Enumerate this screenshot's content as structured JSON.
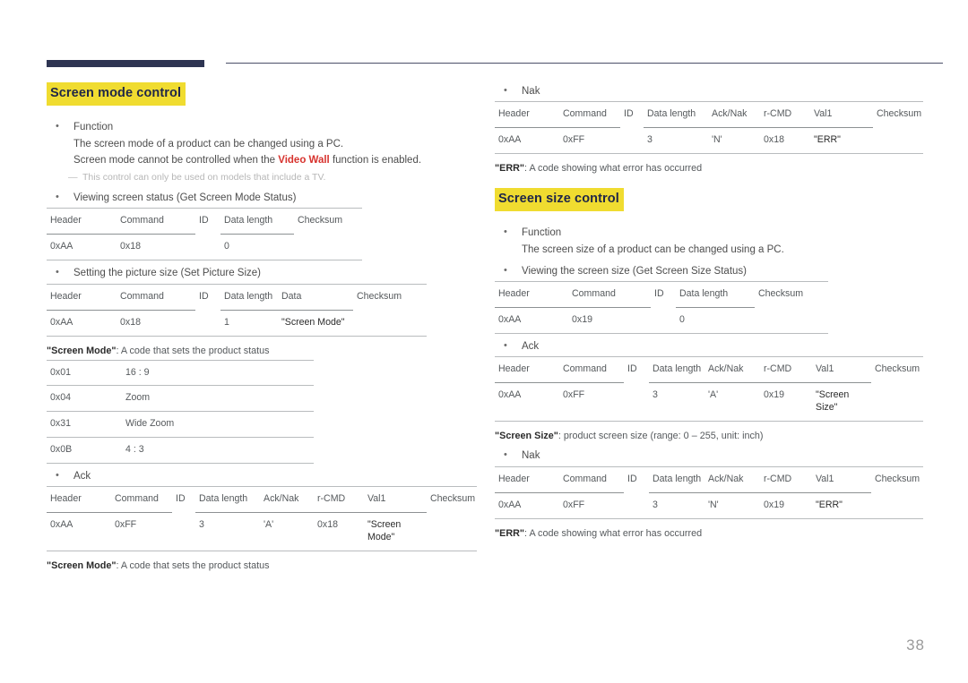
{
  "page_number": "38",
  "colors": {
    "heading_highlight": "#f0dc30",
    "heading_text": "#1f2648",
    "accent_bar": "#2e3452",
    "warning_red": "#d7332e"
  },
  "left": {
    "heading": "Screen mode control",
    "function_bullet": "Function",
    "function_line1": "The screen mode of a product can be changed using a PC.",
    "function_line2_pre": "Screen mode cannot be controlled when the ",
    "function_line2_red": "Video Wall",
    "function_line2_post": " function is enabled.",
    "note": "This control can only be used on models that include a TV.",
    "get_status_bullet": "Viewing screen status (Get Screen Mode Status)",
    "get_status_table": {
      "headers": [
        "Header",
        "Command",
        "ID",
        "Data length",
        "Checksum"
      ],
      "row": [
        "0xAA",
        "0x18",
        "",
        "0",
        ""
      ]
    },
    "set_size_bullet": "Setting the picture size (Set Picture Size)",
    "set_size_table": {
      "headers": [
        "Header",
        "Command",
        "ID",
        "Data length",
        "Data",
        "Checksum"
      ],
      "row": [
        "0xAA",
        "0x18",
        "",
        "1",
        "\"Screen Mode\"",
        ""
      ]
    },
    "caption_set": {
      "term": "\"Screen Mode\"",
      "text": ": A code that sets the product status"
    },
    "codes": {
      "rows": [
        {
          "code": "0x01",
          "label": "16 : 9"
        },
        {
          "code": "0x04",
          "label": "Zoom"
        },
        {
          "code": "0x31",
          "label": "Wide Zoom"
        },
        {
          "code": "0x0B",
          "label": "4 : 3"
        }
      ]
    },
    "ack_bullet": "Ack",
    "ack_table": {
      "headers": [
        "Header",
        "Command",
        "ID",
        "Data length",
        "Ack/Nak",
        "r-CMD",
        "Val1",
        "Checksum"
      ],
      "row": [
        "0xAA",
        "0xFF",
        "",
        "3",
        "'A'",
        "0x18",
        "\"Screen Mode\"",
        ""
      ]
    },
    "caption_ack": {
      "term": "\"Screen Mode\"",
      "text": ": A code that sets the product status"
    }
  },
  "right": {
    "nak_bullet_top": "Nak",
    "nak_table_top": {
      "headers": [
        "Header",
        "Command",
        "ID",
        "Data length",
        "Ack/Nak",
        "r-CMD",
        "Val1",
        "Checksum"
      ],
      "row": [
        "0xAA",
        "0xFF",
        "",
        "3",
        "'N'",
        "0x18",
        "\"ERR\"",
        ""
      ]
    },
    "caption_err_top": {
      "term": "\"ERR\"",
      "text": ": A code showing what error has occurred"
    },
    "heading": "Screen size control",
    "function_bullet": "Function",
    "function_line1": "The screen size of a product can be changed using a PC.",
    "get_status_bullet": "Viewing the screen size (Get Screen Size Status)",
    "get_status_table": {
      "headers": [
        "Header",
        "Command",
        "ID",
        "Data length",
        "Checksum"
      ],
      "row": [
        "0xAA",
        "0x19",
        "",
        "0",
        ""
      ]
    },
    "ack_bullet": "Ack",
    "ack_table": {
      "headers": [
        "Header",
        "Command",
        "ID",
        "Data length",
        "Ack/Nak",
        "r-CMD",
        "Val1",
        "Checksum"
      ],
      "row": [
        "0xAA",
        "0xFF",
        "",
        "3",
        "'A'",
        "0x19",
        "\"Screen Size\"",
        ""
      ]
    },
    "caption_size": {
      "term": "\"Screen Size\"",
      "text": ": product screen size (range: 0 – 255, unit: inch)"
    },
    "nak_bullet_bottom": "Nak",
    "nak_table_bottom": {
      "headers": [
        "Header",
        "Command",
        "ID",
        "Data length",
        "Ack/Nak",
        "r-CMD",
        "Val1",
        "Checksum"
      ],
      "row": [
        "0xAA",
        "0xFF",
        "",
        "3",
        "'N'",
        "0x19",
        "\"ERR\"",
        ""
      ]
    },
    "caption_err_bottom": {
      "term": "\"ERR\"",
      "text": ": A code showing what error has occurred"
    }
  }
}
